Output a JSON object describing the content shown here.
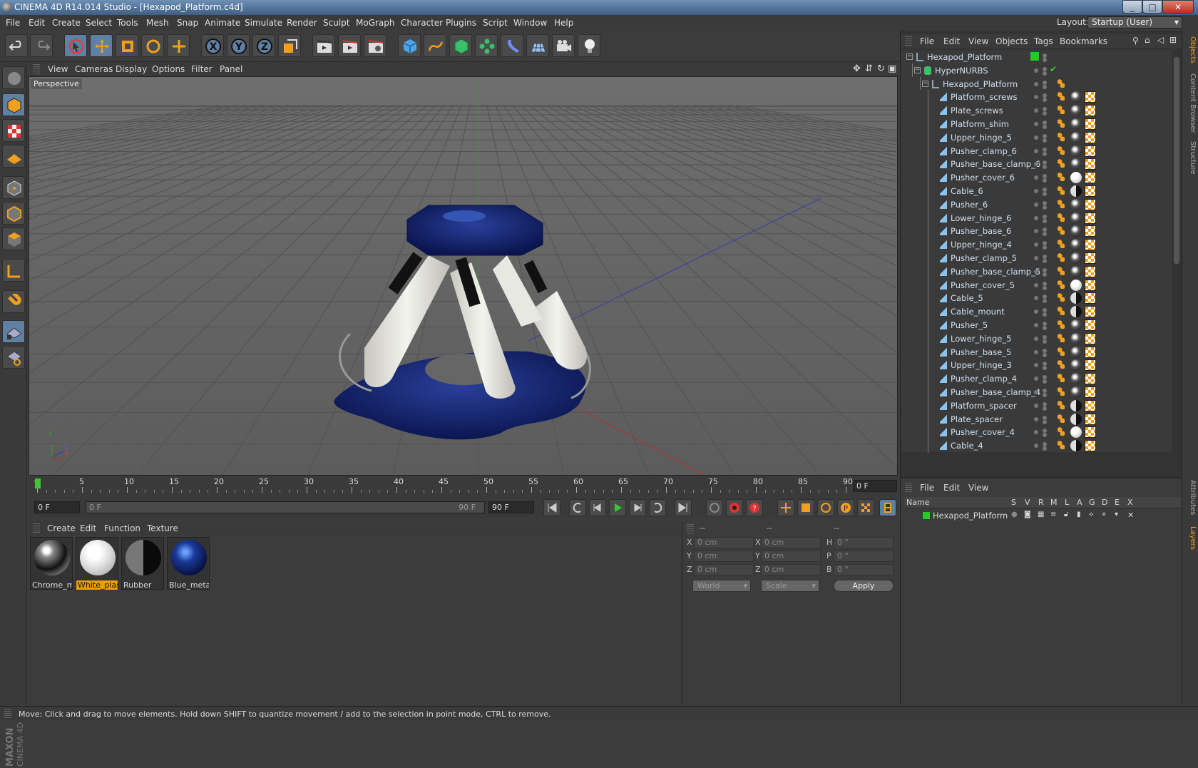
{
  "window": {
    "title": "CINEMA 4D R14.014 Studio - [Hexapod_Platform.c4d]",
    "minimize": "_",
    "maximize": "□",
    "close": "✕"
  },
  "menu": [
    "File",
    "Edit",
    "Create",
    "Select",
    "Tools",
    "Mesh",
    "Snap",
    "Animate",
    "Simulate",
    "Render",
    "Sculpt",
    "MoGraph",
    "Character",
    "Plugins",
    "Script",
    "Window",
    "Help"
  ],
  "layout": {
    "label": "Layout:",
    "value": "Startup (User)"
  },
  "viewport": {
    "menu": [
      "View",
      "Cameras",
      "Display",
      "Options",
      "Filter",
      "Panel"
    ],
    "label": "Perspective",
    "axis": {
      "y": "Y",
      "z": "Z",
      "x": "X"
    }
  },
  "timeline": {
    "ticks": [
      "0",
      "5",
      "10",
      "15",
      "20",
      "25",
      "30",
      "35",
      "40",
      "45",
      "50",
      "55",
      "60",
      "65",
      "70",
      "75",
      "80",
      "85",
      "90"
    ],
    "current_frame": "0 F",
    "start_field": "0 F",
    "range_start": "0 F",
    "range_end": "90 F",
    "end_field": "90 F"
  },
  "material_manager": {
    "menu": [
      "Create",
      "Edit",
      "Function",
      "Texture"
    ],
    "materials": [
      {
        "name": "Chrome_m",
        "selected": false,
        "kind": "chrome"
      },
      {
        "name": "White_plas",
        "selected": true,
        "kind": "white"
      },
      {
        "name": "Rubber",
        "selected": false,
        "kind": "rubber"
      },
      {
        "name": "Blue_metal",
        "selected": false,
        "kind": "blue"
      }
    ]
  },
  "coordinates": {
    "headers": [
      "--",
      "--",
      "--"
    ],
    "rows": [
      {
        "l1": "X",
        "v1": "0 cm",
        "l2": "X",
        "v2": "0 cm",
        "l3": "H",
        "v3": "0 °"
      },
      {
        "l1": "Y",
        "v1": "0 cm",
        "l2": "Y",
        "v2": "0 cm",
        "l3": "P",
        "v3": "0 °"
      },
      {
        "l1": "Z",
        "v1": "0 cm",
        "l2": "Z",
        "v2": "0 cm",
        "l3": "B",
        "v3": "0 °"
      }
    ],
    "mode1": "World",
    "mode2": "Scale",
    "apply": "Apply"
  },
  "object_manager": {
    "menu": [
      "File",
      "Edit",
      "View",
      "Objects",
      "Tags",
      "Bookmarks"
    ],
    "objects": [
      {
        "name": "Hexapod_Platform",
        "indent": 0,
        "type": "null",
        "tags": "green"
      },
      {
        "name": "HyperNURBS",
        "indent": 1,
        "type": "nurbs",
        "tags": "check"
      },
      {
        "name": "Hexapod_Platform",
        "indent": 2,
        "type": "null",
        "tags": "phong"
      },
      {
        "name": "Platform_screws",
        "indent": 3,
        "type": "poly",
        "tags": "chrome"
      },
      {
        "name": "Plate_screws",
        "indent": 3,
        "type": "poly",
        "tags": "chrome"
      },
      {
        "name": "Platform_shim",
        "indent": 3,
        "type": "poly",
        "tags": "chrome"
      },
      {
        "name": "Upper_hinge_5",
        "indent": 3,
        "type": "poly",
        "tags": "chrome"
      },
      {
        "name": "Pusher_clamp_6",
        "indent": 3,
        "type": "poly",
        "tags": "chrome"
      },
      {
        "name": "Pusher_base_clamp_6",
        "indent": 3,
        "type": "poly",
        "tags": "chrome"
      },
      {
        "name": "Pusher_cover_6",
        "indent": 3,
        "type": "poly",
        "tags": "white"
      },
      {
        "name": "Cable_6",
        "indent": 3,
        "type": "poly",
        "tags": "rubber"
      },
      {
        "name": "Pusher_6",
        "indent": 3,
        "type": "poly",
        "tags": "chrome"
      },
      {
        "name": "Lower_hinge_6",
        "indent": 3,
        "type": "poly",
        "tags": "chrome"
      },
      {
        "name": "Pusher_base_6",
        "indent": 3,
        "type": "poly",
        "tags": "chrome"
      },
      {
        "name": "Upper_hinge_4",
        "indent": 3,
        "type": "poly",
        "tags": "chrome"
      },
      {
        "name": "Pusher_clamp_5",
        "indent": 3,
        "type": "poly",
        "tags": "chrome"
      },
      {
        "name": "Pusher_base_clamp_5",
        "indent": 3,
        "type": "poly",
        "tags": "chrome"
      },
      {
        "name": "Pusher_cover_5",
        "indent": 3,
        "type": "poly",
        "tags": "white"
      },
      {
        "name": "Cable_5",
        "indent": 3,
        "type": "poly",
        "tags": "rubber"
      },
      {
        "name": "Cable_mount",
        "indent": 3,
        "type": "poly",
        "tags": "rubber"
      },
      {
        "name": "Pusher_5",
        "indent": 3,
        "type": "poly",
        "tags": "chrome"
      },
      {
        "name": "Lower_hinge_5",
        "indent": 3,
        "type": "poly",
        "tags": "chrome"
      },
      {
        "name": "Pusher_base_5",
        "indent": 3,
        "type": "poly",
        "tags": "chrome"
      },
      {
        "name": "Upper_hinge_3",
        "indent": 3,
        "type": "poly",
        "tags": "chrome"
      },
      {
        "name": "Pusher_clamp_4",
        "indent": 3,
        "type": "poly",
        "tags": "chrome"
      },
      {
        "name": "Pusher_base_clamp_4",
        "indent": 3,
        "type": "poly",
        "tags": "chrome"
      },
      {
        "name": "Platform_spacer",
        "indent": 3,
        "type": "poly",
        "tags": "rubber"
      },
      {
        "name": "Plate_spacer",
        "indent": 3,
        "type": "poly",
        "tags": "rubber"
      },
      {
        "name": "Pusher_cover_4",
        "indent": 3,
        "type": "poly",
        "tags": "white"
      },
      {
        "name": "Cable_4",
        "indent": 3,
        "type": "poly",
        "tags": "rubber"
      }
    ]
  },
  "side_tabs": [
    "Objects",
    "Content Browser",
    "Structure",
    "Attributes",
    "Layers"
  ],
  "layer_manager": {
    "menu": [
      "File",
      "Edit",
      "View"
    ],
    "columns": [
      "Name",
      "S",
      "V",
      "R",
      "M",
      "L",
      "A",
      "G",
      "D",
      "E",
      "X"
    ],
    "layers": [
      {
        "name": "Hexapod_Platform",
        "color": "#22cc22"
      }
    ]
  },
  "status": "Move: Click and drag to move elements. Hold down SHIFT to quantize movement / add to the selection in point mode, CTRL to remove.",
  "brand": {
    "line1": "MAXON",
    "line2": "CINEMA 4D"
  },
  "colors": {
    "accent": "#5f7fa3",
    "selection": "#e8a000",
    "tag_green": "#22cc22"
  }
}
